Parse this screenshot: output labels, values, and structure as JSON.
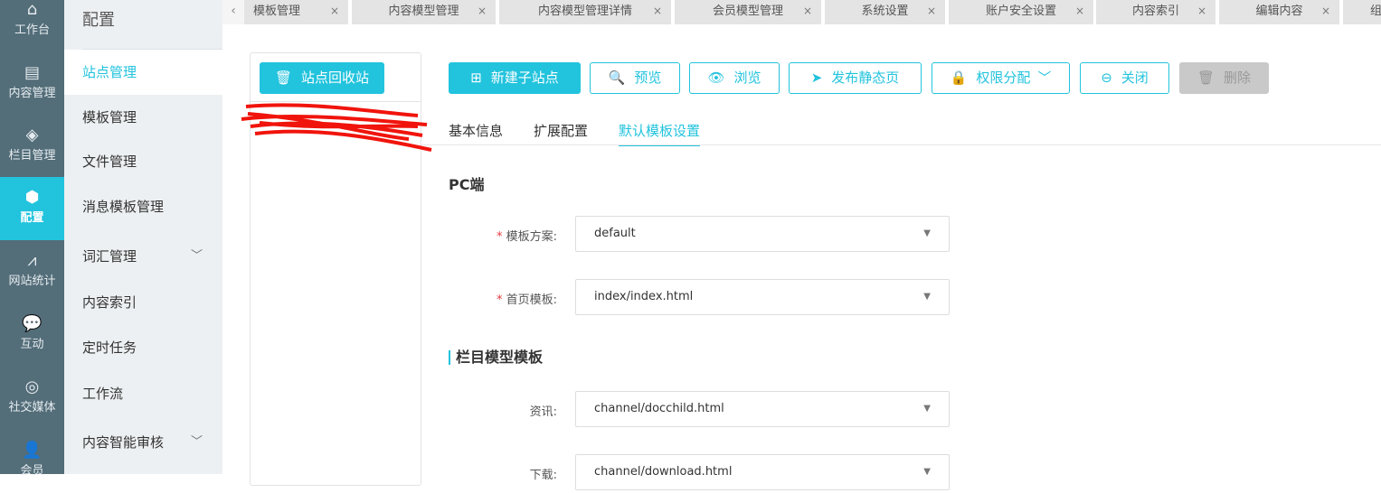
{
  "rail": [
    {
      "label": "工作台",
      "icon": "home-icon"
    },
    {
      "label": "内容管理",
      "icon": "document-icon"
    },
    {
      "label": "栏目管理",
      "icon": "layers-icon"
    },
    {
      "label": "配置",
      "icon": "cube-icon"
    },
    {
      "label": "网站统计",
      "icon": "chart-icon"
    },
    {
      "label": "互动",
      "icon": "chat-icon"
    },
    {
      "label": "社交媒体",
      "icon": "target-icon"
    },
    {
      "label": "会员",
      "icon": "user-icon"
    }
  ],
  "menu": {
    "title": "配置",
    "items": [
      "站点管理",
      "模板管理",
      "文件管理",
      "消息模板管理",
      "词汇管理",
      "内容索引",
      "定时任务",
      "工作流",
      "内容智能审核"
    ]
  },
  "tabs": [
    "模板管理",
    "内容模型管理",
    "内容模型管理详情",
    "会员模型管理",
    "系统设置",
    "账户安全设置",
    "内容索引",
    "编辑内容",
    "组"
  ],
  "recycle_button": "站点回收站",
  "toolbar": {
    "new_child": "新建子站点",
    "preview": "预览",
    "browse": "浏览",
    "publish": "发布静态页",
    "permission": "权限分配",
    "close": "关闭",
    "delete": "删除"
  },
  "subtabs": [
    "基本信息",
    "扩展配置",
    "默认模板设置"
  ],
  "pc": {
    "heading": "PC端",
    "scheme_label": "模板方案:",
    "scheme_value": "default",
    "home_label": "首页模板:",
    "home_value": "index/index.html"
  },
  "channel": {
    "heading": "栏目模型模板",
    "news_label": "资讯:",
    "news_value": "channel/docchild.html",
    "download_label": "下载:",
    "download_value": "channel/download.html"
  },
  "colors": {
    "accent": "#22c3dd",
    "rail": "#536d79"
  }
}
